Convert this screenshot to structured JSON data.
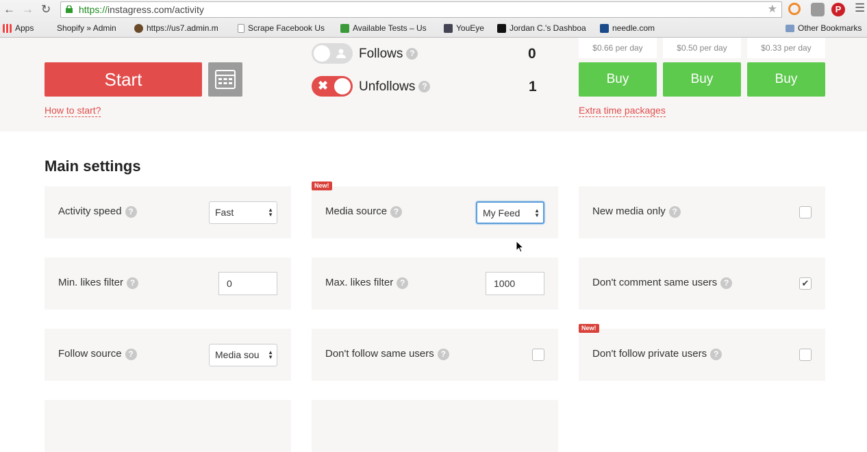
{
  "browser": {
    "url_scheme": "https://",
    "url_rest": "instagress.com/activity",
    "bookmarks": [
      {
        "label": "Apps",
        "icon": "apps-grid-icon"
      },
      {
        "label": "Shopify » Admin",
        "icon": "shopify-icon"
      },
      {
        "label": "https://us7.admin.m",
        "icon": "mailchimp-icon"
      },
      {
        "label": "Scrape Facebook Us",
        "icon": "page-icon"
      },
      {
        "label": "Available Tests – Us",
        "icon": "usertesting-icon"
      },
      {
        "label": "YouEye",
        "icon": "youeye-icon"
      },
      {
        "label": "Jordan C.'s Dashboa",
        "icon": "m-icon"
      },
      {
        "label": "needle.com",
        "icon": "n-icon"
      },
      {
        "label": "Other Bookmarks",
        "icon": "folder-icon"
      }
    ]
  },
  "top": {
    "start_label": "Start",
    "how_to_start": "How to start?",
    "follows_label": "Follows",
    "follows_count": "0",
    "follows_on": false,
    "unfollows_label": "Unfollows",
    "unfollows_count": "1",
    "unfollows_on": true,
    "packages": [
      {
        "price": "$0.66 per day",
        "buy": "Buy"
      },
      {
        "price": "$0.50 per day",
        "buy": "Buy"
      },
      {
        "price": "$0.33 per day",
        "buy": "Buy"
      }
    ],
    "extra_time": "Extra time packages"
  },
  "main": {
    "title": "Main settings",
    "new_badge": "New!",
    "help": "?",
    "activity_speed": {
      "label": "Activity speed",
      "value": "Fast"
    },
    "media_source": {
      "label": "Media source",
      "value": "My Feed"
    },
    "new_media_only": {
      "label": "New media only",
      "checked": false
    },
    "min_likes": {
      "label": "Min. likes filter",
      "value": "0"
    },
    "max_likes": {
      "label": "Max. likes filter",
      "value": "1000"
    },
    "dont_comment_same": {
      "label": "Don't comment same users",
      "checked": true,
      "mark": "✔"
    },
    "follow_source": {
      "label": "Follow source",
      "value": "Media sou"
    },
    "dont_follow_same": {
      "label": "Don't follow same users",
      "checked": false
    },
    "dont_follow_private": {
      "label": "Don't follow private users",
      "checked": false
    }
  }
}
